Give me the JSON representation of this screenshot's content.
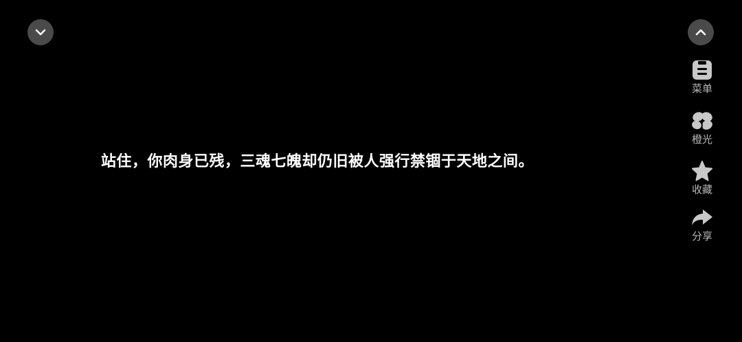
{
  "controls": {
    "collapse_icon": "chevron-down-icon",
    "expand_icon": "chevron-up-icon"
  },
  "sidebar": {
    "items": [
      {
        "label": "菜单",
        "icon": "menu-icon"
      },
      {
        "label": "橙光",
        "icon": "clover-icon"
      },
      {
        "label": "收藏",
        "icon": "star-icon"
      },
      {
        "label": "分享",
        "icon": "share-icon"
      }
    ]
  },
  "dialogue": {
    "text": "站住，你肉身已残，三魂七魄却仍旧被人强行禁锢于天地之间。"
  },
  "colors": {
    "background": "#000000",
    "button_bg": "#4a4a4a",
    "icon": "#c8c8c8",
    "text": "#ffffff"
  }
}
